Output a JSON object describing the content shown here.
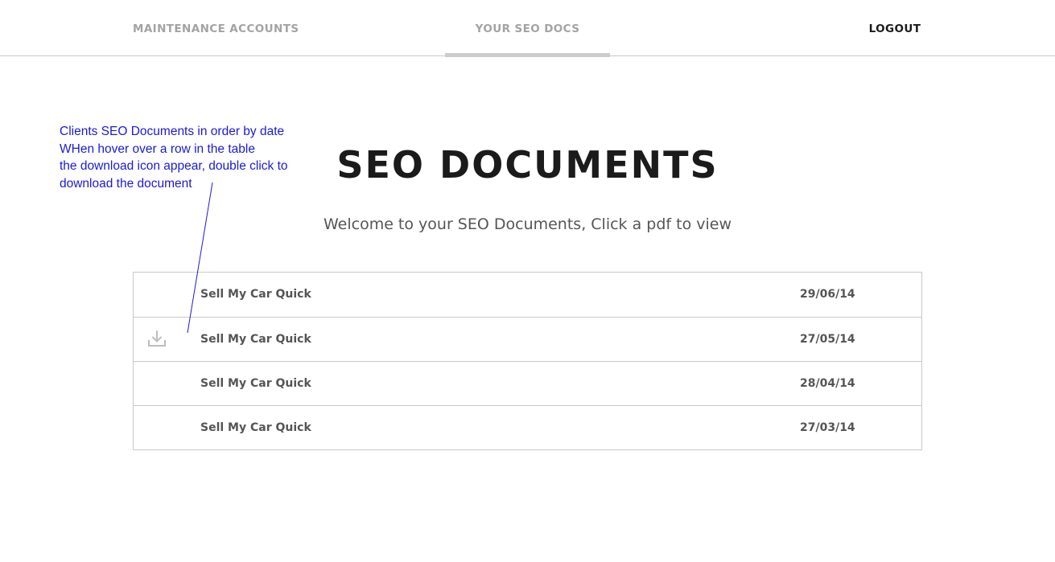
{
  "nav": {
    "maintenance_label": "MAINTENANCE ACCOUNTS",
    "seo_docs_label": "YOUR SEO DOCS",
    "logout_label": "LOGOUT"
  },
  "annotation": {
    "lines": [
      "Clients SEO Documents in order by date",
      "WHen hover over a row in the table",
      "the download icon appear, double click to",
      "download the document"
    ],
    "color": "#1a1ad6"
  },
  "main": {
    "title": "SEO DOCUMENTS",
    "subtitle": "Welcome to your SEO Documents, Click a pdf to view"
  },
  "documents": [
    {
      "name": "Sell My Car Quick",
      "date": "29/06/14",
      "show_download_icon": false
    },
    {
      "name": "Sell My Car Quick",
      "date": "27/05/14",
      "show_download_icon": true,
      "icon": "download-icon"
    },
    {
      "name": "Sell My Car Quick",
      "date": "28/04/14",
      "show_download_icon": false
    },
    {
      "name": "Sell My Car Quick",
      "date": "27/03/14",
      "show_download_icon": false
    }
  ]
}
